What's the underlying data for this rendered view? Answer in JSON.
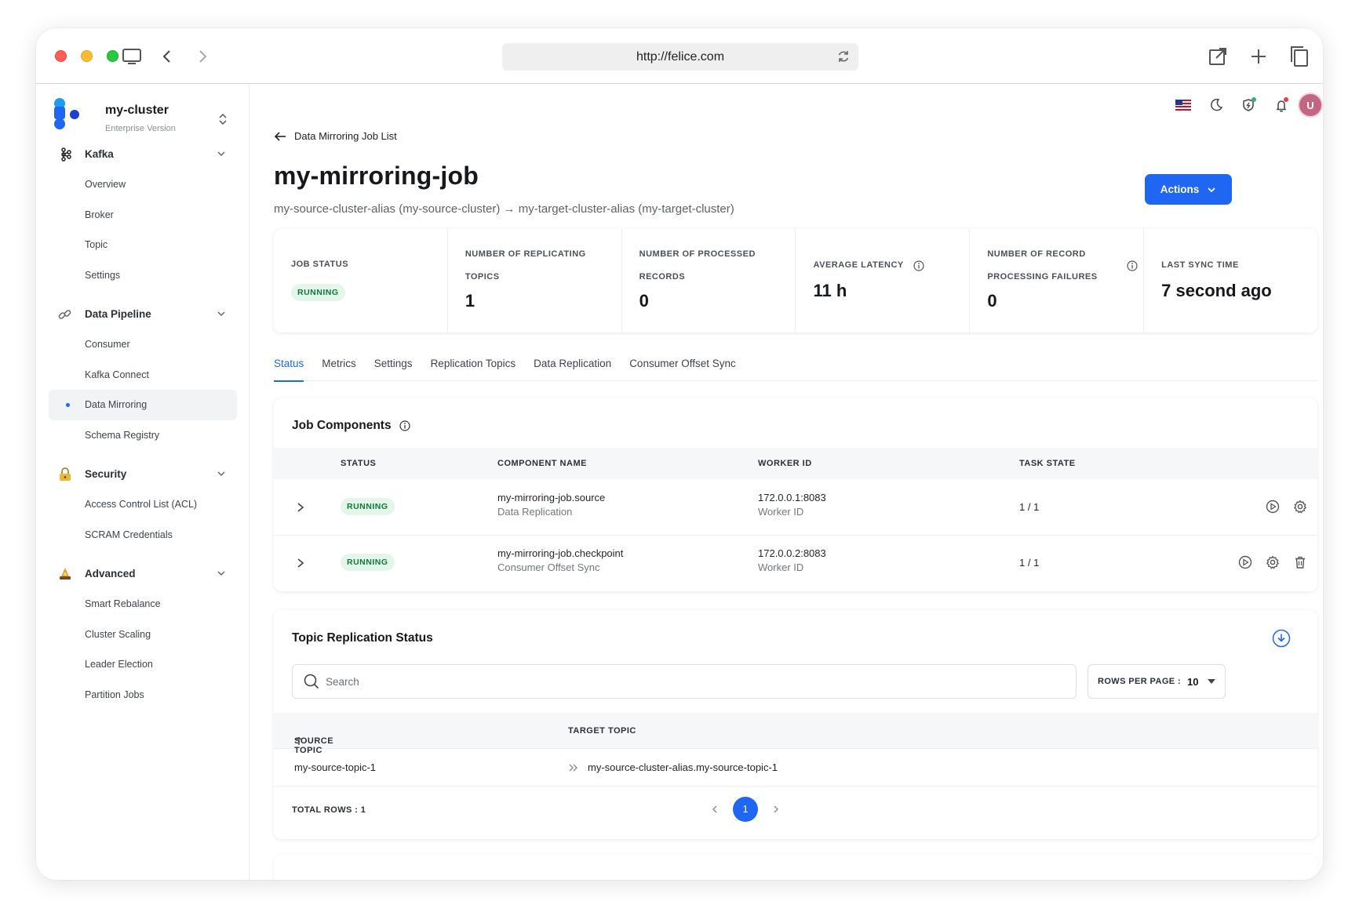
{
  "browser": {
    "url": "http://felice.com"
  },
  "sidebar": {
    "cluster_name": "my-cluster",
    "cluster_version": "Enterprise Version",
    "groups": [
      {
        "label": "Kafka",
        "icon": "kafka-icon",
        "items": [
          "Overview",
          "Broker",
          "Topic",
          "Settings"
        ]
      },
      {
        "label": "Data Pipeline",
        "icon": "link-icon",
        "items": [
          "Consumer",
          "Kafka Connect",
          "Data Mirroring",
          "Schema Registry"
        ]
      },
      {
        "label": "Security",
        "icon": "lock-icon",
        "items": [
          "Access Control List (ACL)",
          "SCRAM Credentials"
        ]
      },
      {
        "label": "Advanced",
        "icon": "wizard-icon",
        "items": [
          "Smart Rebalance",
          "Cluster Scaling",
          "Leader Election",
          "Partition Jobs"
        ]
      }
    ],
    "active_item": "Data Mirroring"
  },
  "header": {
    "avatar_initial": "U"
  },
  "page": {
    "back_label": "Data Mirroring Job List",
    "title": "my-mirroring-job",
    "subtitle": "my-source-cluster-alias (my-source-cluster) → my-target-cluster-alias (my-target-cluster)",
    "actions_label": "Actions"
  },
  "stats": {
    "job_status_label": "JOB STATUS",
    "job_status_value": "RUNNING",
    "replicating_label_1": "NUMBER OF REPLICATING",
    "replicating_label_2": "TOPICS",
    "replicating_value": "1",
    "processed_label_1": "NUMBER OF PROCESSED",
    "processed_label_2": "RECORDS",
    "processed_value": "0",
    "latency_label": "AVERAGE LATENCY",
    "latency_value": "11 h",
    "failures_label_1": "NUMBER OF RECORD",
    "failures_label_2": "PROCESSING FAILURES",
    "failures_value": "0",
    "sync_label": "LAST SYNC TIME",
    "sync_value": "7 second ago"
  },
  "tabs": [
    "Status",
    "Metrics",
    "Settings",
    "Replication Topics",
    "Data Replication",
    "Consumer Offset Sync"
  ],
  "active_tab": "Status",
  "job_components": {
    "title": "Job Components",
    "columns": [
      "STATUS",
      "COMPONENT NAME",
      "WORKER ID",
      "TASK STATE"
    ],
    "rows": [
      {
        "status": "RUNNING",
        "name": "my-mirroring-job.source",
        "type": "Data Replication",
        "worker": "172.0.0.1:8083",
        "worker_label": "Worker ID",
        "task_state": "1 / 1"
      },
      {
        "status": "RUNNING",
        "name": "my-mirroring-job.checkpoint",
        "type": "Consumer Offset Sync",
        "worker": "172.0.0.2:8083",
        "worker_label": "Worker ID",
        "task_state": "1 / 1"
      }
    ]
  },
  "topic_replication": {
    "title": "Topic Replication Status",
    "search_placeholder": "Search",
    "rows_per_page_label": "ROWS PER PAGE :",
    "rows_per_page_value": "10",
    "columns": [
      "SOURCE TOPIC",
      "TARGET TOPIC"
    ],
    "rows": [
      {
        "source": "my-source-topic-1",
        "target": "my-source-cluster-alias.my-source-topic-1"
      }
    ],
    "total_rows_label": "TOTAL ROWS : 1",
    "current_page": "1"
  },
  "colors": {
    "accent": "#1f66f2",
    "success_bg": "#e4f6ea",
    "success_text": "#0f7a3a",
    "avatar": "#c26684"
  }
}
